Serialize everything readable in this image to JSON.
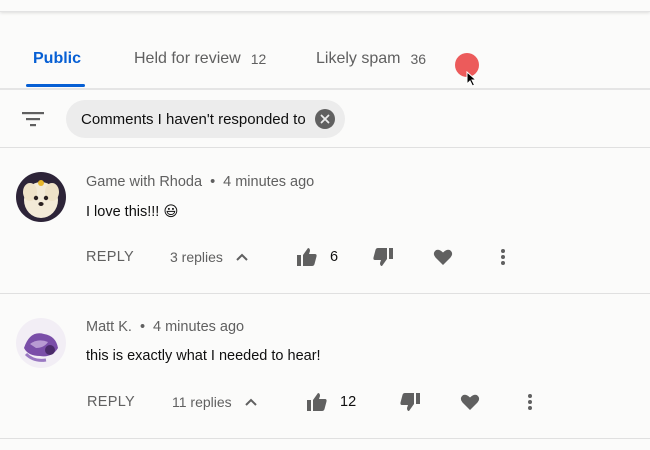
{
  "tabs": [
    {
      "label": "Public",
      "count": ""
    },
    {
      "label": "Held for review",
      "count": "12"
    },
    {
      "label": "Likely spam",
      "count": "36"
    }
  ],
  "colors": {
    "accent": "#065fd4",
    "cursor": "#ec5b5b"
  },
  "filter": {
    "chip_label": "Comments I haven't responded to"
  },
  "comments": [
    {
      "author": "Game with Rhoda",
      "separator": "•",
      "time": "4 minutes ago",
      "text": "I love this!!! 😃",
      "reply_label": "REPLY",
      "replies": "3 replies",
      "likes": "6"
    },
    {
      "author": "Matt K.",
      "separator": "•",
      "time": "4 minutes ago",
      "text": "this is exactly what I needed to hear!",
      "reply_label": "REPLY",
      "replies": "11 replies",
      "likes": "12"
    }
  ]
}
